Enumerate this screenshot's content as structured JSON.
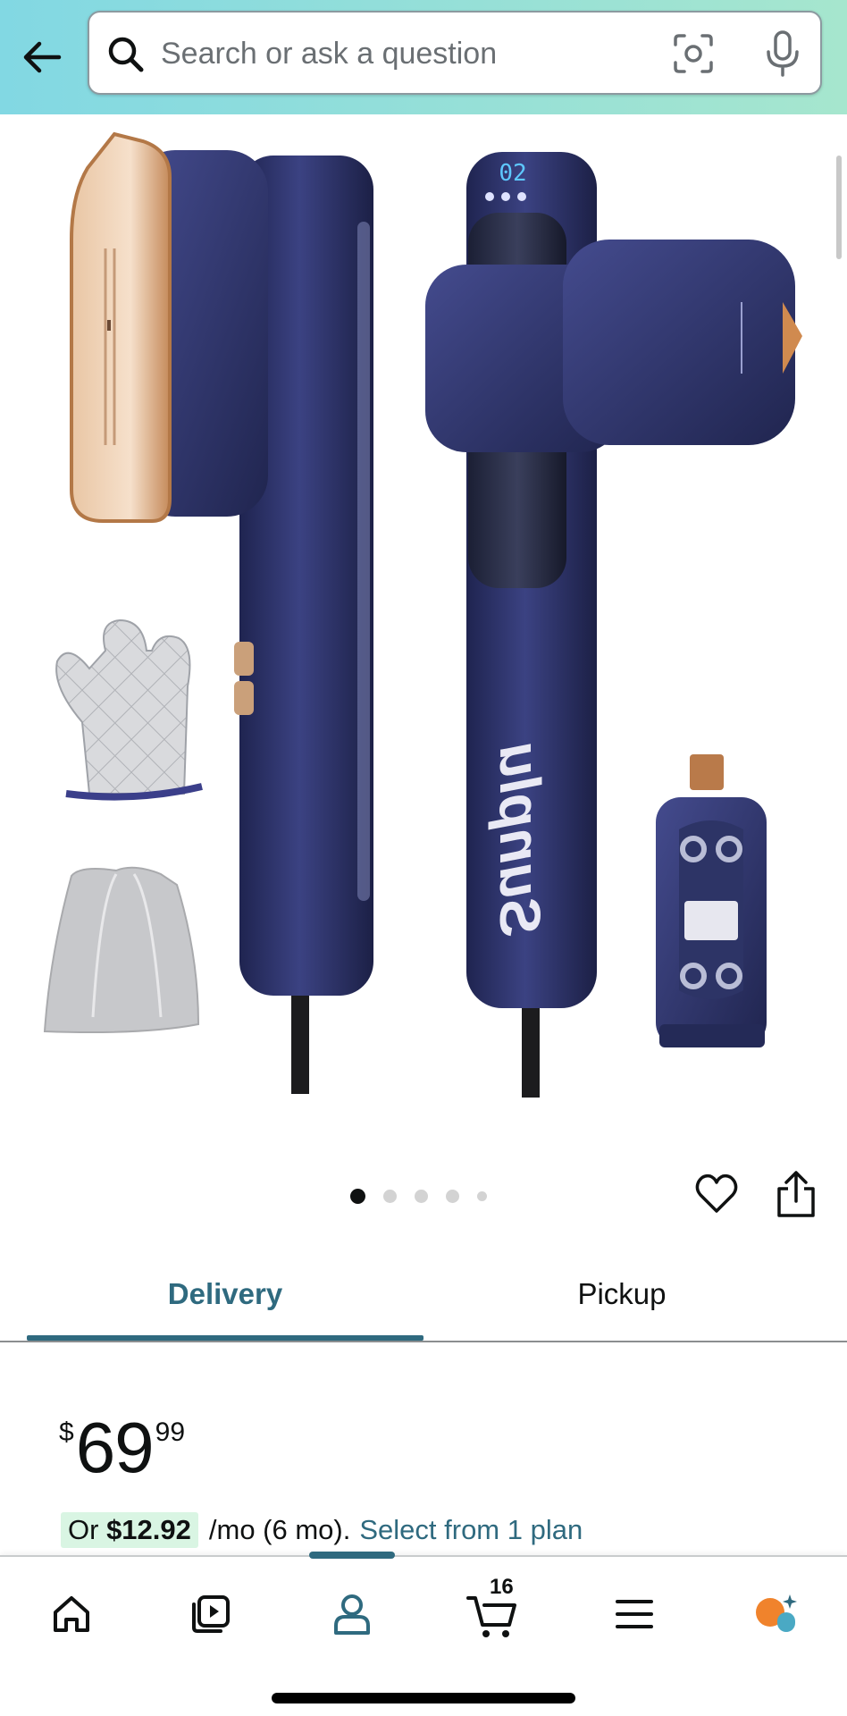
{
  "search": {
    "placeholder": "Search or ask a question",
    "value": ""
  },
  "gallery": {
    "current_index": 1,
    "total_indicators": 5,
    "product_brand_mark": "Sunplu",
    "display_readout": "02"
  },
  "tabs": [
    {
      "label": "Delivery",
      "selected": true
    },
    {
      "label": "Pickup",
      "selected": false
    }
  ],
  "price": {
    "symbol": "$",
    "whole": "69",
    "fraction": "99"
  },
  "plan": {
    "prefix": "Or",
    "amount": "$12.92",
    "terms": "/mo (6 mo).",
    "link": "Select from 1 plan"
  },
  "nav": {
    "items": [
      "home-icon",
      "video-icon",
      "account-icon",
      "cart-icon",
      "menu-icon",
      "rufus-icon"
    ],
    "cart_count": "16"
  },
  "colors": {
    "accent": "#2f6a7f",
    "header_gradient_start": "#82d8e3",
    "header_gradient_end": "#a6e6ce",
    "plan_highlight": "#d9f5e3",
    "product_navy": "#2c3266",
    "rufus_orange": "#f0832c",
    "rufus_teal": "#4aa9c4"
  },
  "icons": {
    "back": "arrow-left-icon",
    "search": "search-icon",
    "camera": "camera-scan-icon",
    "mic": "microphone-icon",
    "wishlist": "heart-icon",
    "share": "share-icon"
  }
}
